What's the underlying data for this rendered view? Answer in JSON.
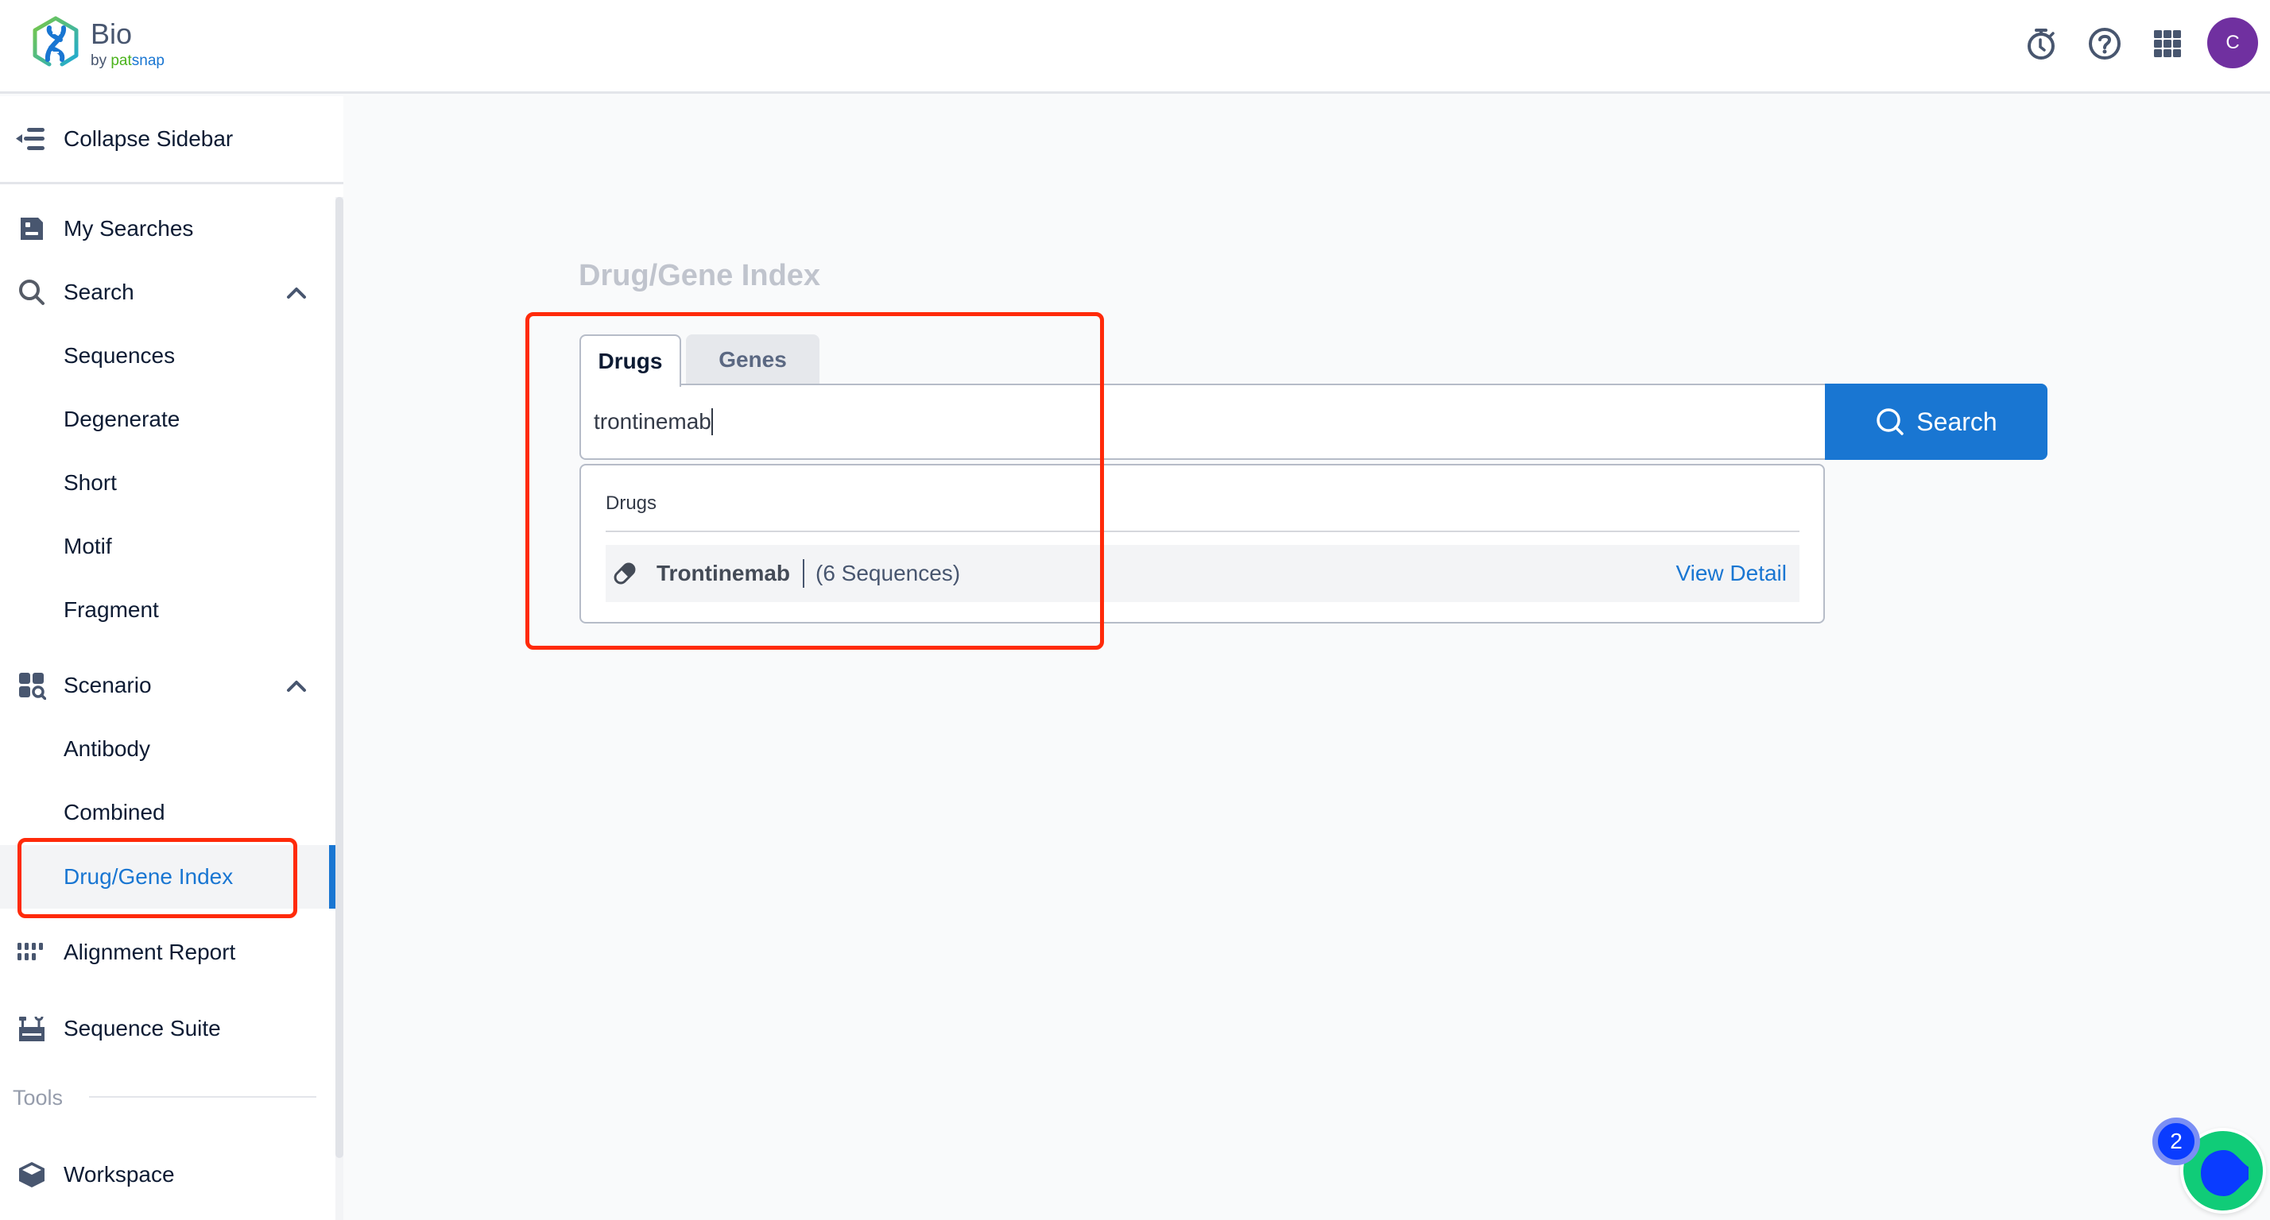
{
  "header": {
    "logo_title": "Bio",
    "logo_by": "by",
    "logo_pat": "pat",
    "logo_snap": "snap",
    "icons": [
      "stopwatch-icon",
      "help-icon",
      "apps-grid-icon"
    ],
    "avatar_initial": "C"
  },
  "sidebar": {
    "collapse_label": "Collapse Sidebar",
    "items": [
      {
        "label": "My Searches",
        "icon": "my-searches-icon"
      },
      {
        "label": "Search",
        "icon": "search-icon",
        "expanded": true
      },
      {
        "label": "Sequences"
      },
      {
        "label": "Degenerate"
      },
      {
        "label": "Short"
      },
      {
        "label": "Motif"
      },
      {
        "label": "Fragment"
      },
      {
        "label": "Scenario",
        "icon": "scenario-icon",
        "expanded": true
      },
      {
        "label": "Antibody"
      },
      {
        "label": "Combined"
      },
      {
        "label": "Drug/Gene Index",
        "active": true
      },
      {
        "label": "Alignment Report",
        "icon": "alignment-report-icon"
      },
      {
        "label": "Sequence Suite",
        "icon": "sequence-suite-icon"
      }
    ],
    "tools_section_label": "Tools",
    "tools_items": [
      {
        "label": "Workspace",
        "icon": "workspace-icon"
      }
    ]
  },
  "main": {
    "title": "Drug/Gene Index",
    "tabs": [
      {
        "label": "Drugs",
        "active": true
      },
      {
        "label": "Genes",
        "active": false
      }
    ],
    "search": {
      "value": "trontinemab",
      "button_label": "Search"
    },
    "dropdown": {
      "section_header": "Drugs",
      "results": [
        {
          "name": "Trontinemab",
          "count_text": "(6 Sequences)",
          "action_label": "View Detail"
        }
      ]
    }
  },
  "widget": {
    "badge_count": "2"
  },
  "colors": {
    "accent": "#1976D2",
    "avatar": "#7030A0",
    "annotation": "#FF2A0A",
    "widget_green": "#10CC78",
    "widget_blue": "#0A3CFF"
  }
}
